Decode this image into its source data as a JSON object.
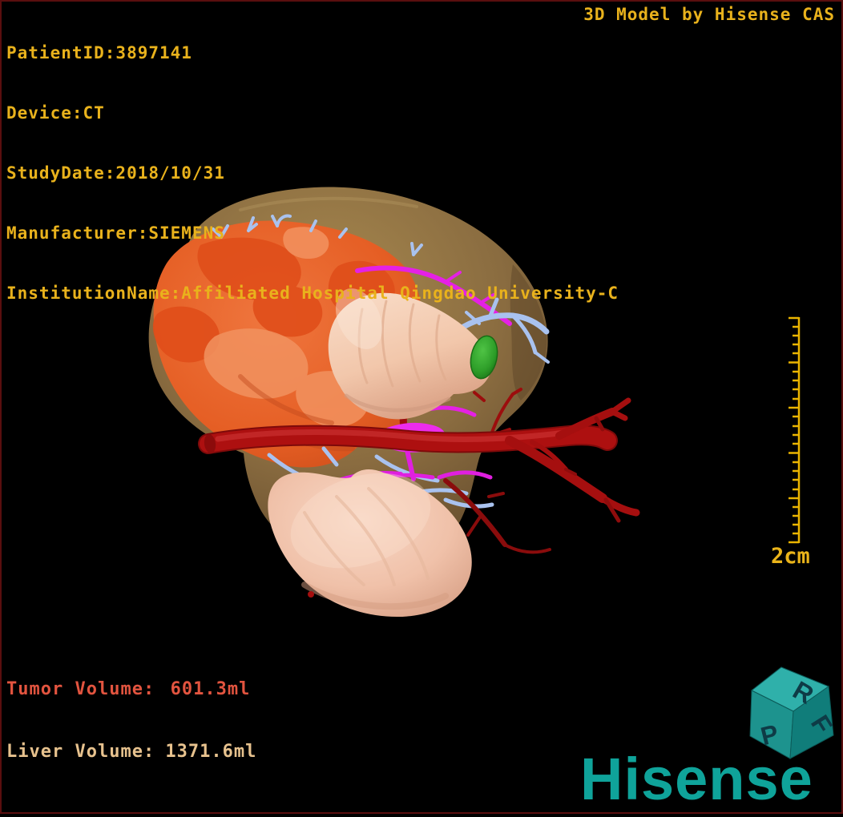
{
  "overlay": {
    "patient_info": [
      "PatientID:3897141",
      "Device:CT",
      "StudyDate:2018/10/31",
      "Manufacturer:SIEMENS",
      "InstitutionName:Affiliated Hospital Qingdao University-C"
    ],
    "watermark": "3D Model by Hisense CAS",
    "volumes": {
      "tumor": {
        "label": "Tumor Volume:",
        "value": "601.3ml"
      },
      "liver": {
        "label": "Liver Volume:",
        "value": "1371.6ml"
      }
    }
  },
  "scale": {
    "label": "2cm"
  },
  "orientation_cube": {
    "top_letter": "R",
    "left_letter": "P",
    "right_letter": "F"
  },
  "branding": {
    "logo_text": "Hisense"
  },
  "colors": {
    "background": "#000000",
    "viewport_border": "#5a0e0e",
    "overlay_text": "#e9b21c",
    "tumor_text": "#e2543f",
    "liver_text": "#e7c28e",
    "brand_teal": "#0fa39a",
    "scale_gold": "#eab400"
  },
  "model": {
    "structures": [
      {
        "name": "liver",
        "color": "#96784a"
      },
      {
        "name": "tumor",
        "color": "#e9662f"
      },
      {
        "name": "stomach",
        "color": "#f2c9b1"
      },
      {
        "name": "gallbladder",
        "color": "#2ea22b"
      },
      {
        "name": "hepatic-artery",
        "color": "#ad1010"
      },
      {
        "name": "hepatic-veins",
        "color": "#a9c2ef"
      },
      {
        "name": "portal-veins",
        "color": "#e520e5"
      }
    ]
  }
}
